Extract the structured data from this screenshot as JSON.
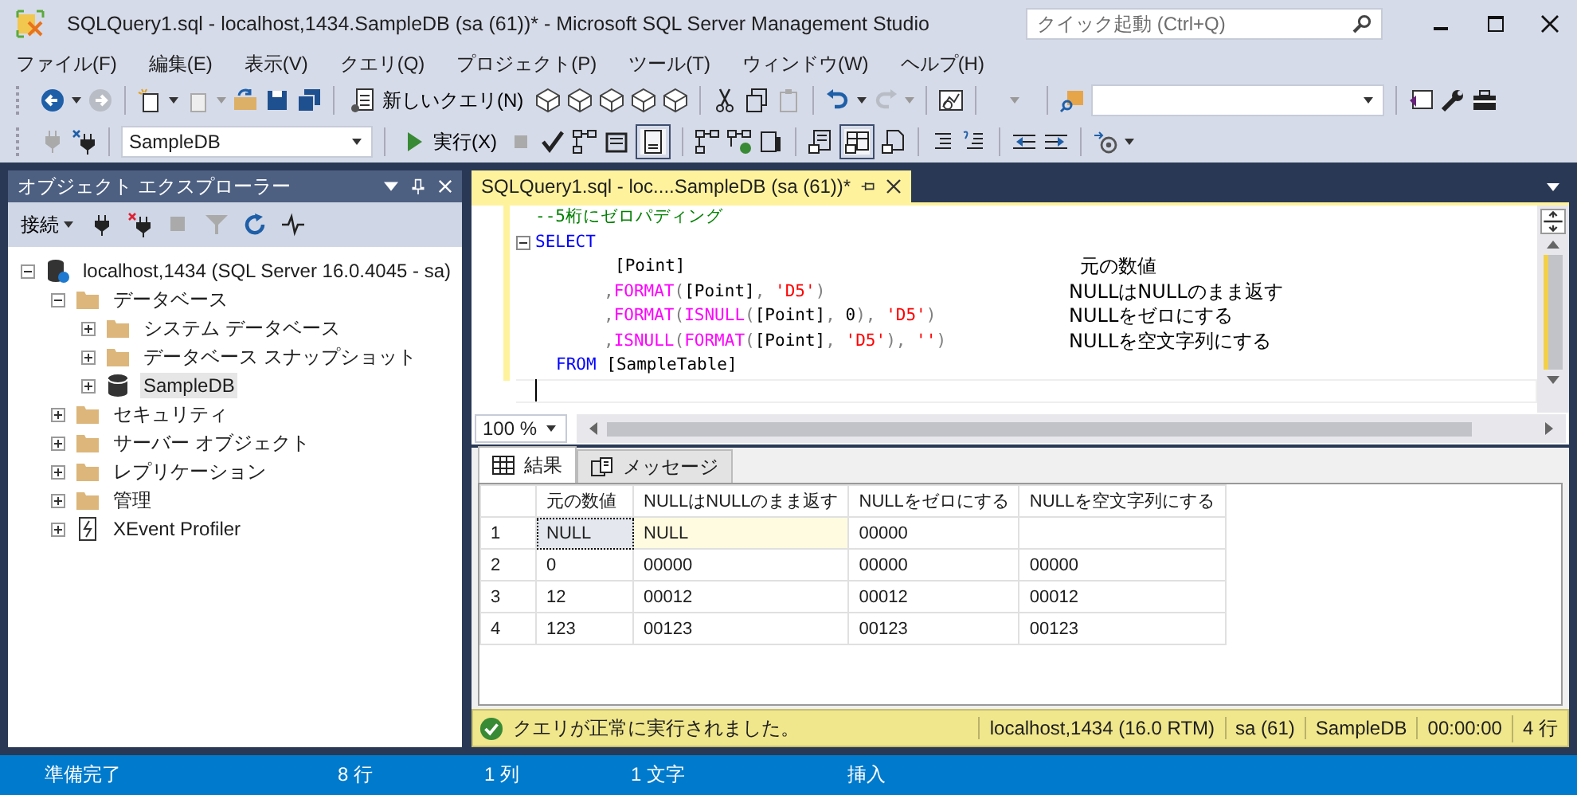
{
  "window": {
    "title": "SQLQuery1.sql - localhost,1434.SampleDB (sa (61))* - Microsoft SQL Server Management Studio",
    "quick_launch": {
      "placeholder": "クイック起動 (Ctrl+Q)"
    }
  },
  "menu": [
    "ファイル(F)",
    "編集(E)",
    "表示(V)",
    "クエリ(Q)",
    "プロジェクト(P)",
    "ツール(T)",
    "ウィンドウ(W)",
    "ヘルプ(H)"
  ],
  "toolbar": {
    "new_query": "新しいクエリ(N)",
    "database": "SampleDB",
    "execute": "実行(X)"
  },
  "explorer": {
    "title": "オブジェクト エクスプローラー",
    "connect": "接続",
    "tree": [
      {
        "label": "localhost,1434 (SQL Server 16.0.4045 - sa)",
        "kind": "server",
        "expanded": true,
        "selected": false,
        "children": [
          {
            "label": "データベース",
            "kind": "folder",
            "expanded": true,
            "selected": false,
            "children": [
              {
                "label": "システム データベース",
                "kind": "folder",
                "expanded": false,
                "selected": false
              },
              {
                "label": "データベース スナップショット",
                "kind": "folder",
                "expanded": false,
                "selected": false
              },
              {
                "label": "SampleDB",
                "kind": "database",
                "expanded": false,
                "selected": true
              }
            ]
          },
          {
            "label": "セキュリティ",
            "kind": "folder",
            "expanded": false,
            "selected": false
          },
          {
            "label": "サーバー オブジェクト",
            "kind": "folder",
            "expanded": false,
            "selected": false
          },
          {
            "label": "レプリケーション",
            "kind": "folder",
            "expanded": false,
            "selected": false
          },
          {
            "label": "管理",
            "kind": "folder",
            "expanded": false,
            "selected": false
          },
          {
            "label": "XEvent Profiler",
            "kind": "profiler",
            "expanded": false,
            "selected": false
          }
        ]
      }
    ]
  },
  "editor": {
    "tab": "SQLQuery1.sql - loc....SampleDB (sa (61))*",
    "lines": [
      {
        "kind": "comment",
        "segments": [
          {
            "kind": "comment",
            "text": "--5桁にゼロパディング"
          }
        ]
      },
      {
        "kind": "select",
        "folded": false,
        "segments": [
          {
            "kind": "keyword",
            "text": "SELECT"
          }
        ]
      },
      {
        "kind": "first_column",
        "segments": [
          {
            "kind": "plain",
            "text": "[Point]"
          }
        ],
        "note": "元の数値"
      },
      {
        "kind": "column",
        "lead": ",",
        "segments": [
          {
            "kind": "func",
            "text": "FORMAT"
          },
          {
            "kind": "punct",
            "text": "("
          },
          {
            "kind": "plain",
            "text": "[Point]"
          },
          {
            "kind": "punct",
            "text": ", "
          },
          {
            "kind": "string",
            "text": "'D5'"
          },
          {
            "kind": "punct",
            "text": ")"
          }
        ],
        "note": "NULLはNULLのまま返す"
      },
      {
        "kind": "column",
        "lead": ",",
        "segments": [
          {
            "kind": "func",
            "text": "FORMAT"
          },
          {
            "kind": "punct",
            "text": "("
          },
          {
            "kind": "func",
            "text": "ISNULL"
          },
          {
            "kind": "punct",
            "text": "("
          },
          {
            "kind": "plain",
            "text": "[Point]"
          },
          {
            "kind": "punct",
            "text": ", "
          },
          {
            "kind": "plain",
            "text": "0"
          },
          {
            "kind": "punct",
            "text": "), "
          },
          {
            "kind": "string",
            "text": "'D5'"
          },
          {
            "kind": "punct",
            "text": ")"
          }
        ],
        "note": "NULLをゼロにする"
      },
      {
        "kind": "column",
        "lead": ",",
        "segments": [
          {
            "kind": "func",
            "text": "ISNULL"
          },
          {
            "kind": "punct",
            "text": "("
          },
          {
            "kind": "func",
            "text": "FORMAT"
          },
          {
            "kind": "punct",
            "text": "("
          },
          {
            "kind": "plain",
            "text": "[Point]"
          },
          {
            "kind": "punct",
            "text": ", "
          },
          {
            "kind": "string",
            "text": "'D5'"
          },
          {
            "kind": "punct",
            "text": "), "
          },
          {
            "kind": "string",
            "text": "''"
          },
          {
            "kind": "punct",
            "text": ")"
          }
        ],
        "note": "NULLを空文字列にする"
      },
      {
        "kind": "from",
        "segments": [
          {
            "kind": "keyword",
            "text": "FROM"
          },
          {
            "kind": "plain",
            "text": " [SampleTable]"
          }
        ]
      },
      {
        "kind": "cursor"
      }
    ],
    "zoom": "100 %"
  },
  "results": {
    "tabs": [
      {
        "label": "結果",
        "selected": true
      },
      {
        "label": "メッセージ",
        "selected": false
      }
    ],
    "columns": [
      "元の数値",
      "NULLはNULLのまま返す",
      "NULLをゼロにする",
      "NULLを空文字列にする"
    ],
    "rows": [
      {
        "number": "1",
        "cells": [
          {
            "text": "NULL",
            "null": true,
            "selected": true
          },
          {
            "text": "NULL",
            "null": true,
            "selected": false
          },
          {
            "text": "00000",
            "null": false,
            "selected": false
          },
          {
            "null": false,
            "selected": false
          }
        ]
      },
      {
        "number": "2",
        "cells": [
          {
            "text": "0",
            "null": false,
            "selected": false
          },
          {
            "text": "00000",
            "null": false,
            "selected": false
          },
          {
            "text": "00000",
            "null": false,
            "selected": false
          },
          {
            "text": "00000",
            "null": false,
            "selected": false
          }
        ]
      },
      {
        "number": "3",
        "cells": [
          {
            "text": "12",
            "null": false,
            "selected": false
          },
          {
            "text": "00012",
            "null": false,
            "selected": false
          },
          {
            "text": "00012",
            "null": false,
            "selected": false
          },
          {
            "text": "00012",
            "null": false,
            "selected": false
          }
        ]
      },
      {
        "number": "4",
        "cells": [
          {
            "text": "123",
            "null": false,
            "selected": false
          },
          {
            "text": "00123",
            "null": false,
            "selected": false
          },
          {
            "text": "00123",
            "null": false,
            "selected": false
          },
          {
            "text": "00123",
            "null": false,
            "selected": false
          }
        ]
      }
    ]
  },
  "query_status": {
    "message": "クエリが正常に実行されました。",
    "server": "localhost,1434 (16.0 RTM)",
    "user": "sa (61)",
    "database": "SampleDB",
    "elapsed": "00:00:00",
    "rows": "4 行"
  },
  "status_bar": {
    "state": "準備完了",
    "line": "8 行",
    "column": "1 列",
    "char": "1 文字",
    "mode": "挿入"
  }
}
